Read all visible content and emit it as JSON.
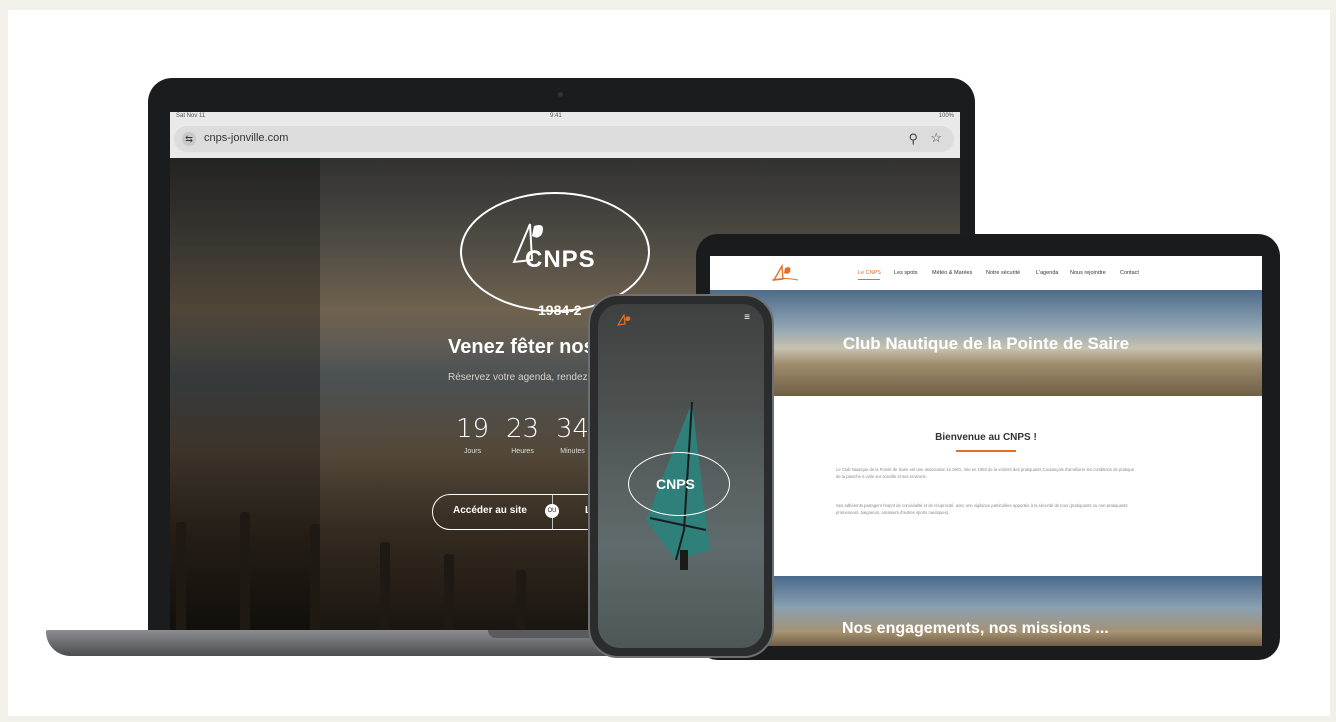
{
  "laptop": {
    "status_left": "Sat Nov 11",
    "status_center": "9:41",
    "status_right": "100%",
    "url": "cnps-jonville.com",
    "logo_text": "CNPS",
    "year_text": "1984-2",
    "hero_title": "Venez fêter nos",
    "hero_subtitle": "Réservez votre agenda, rendez vo",
    "countdown": [
      {
        "value": "19",
        "unit": "Jours"
      },
      {
        "value": "23",
        "unit": "Heures"
      },
      {
        "value": "34",
        "unit": "Minutes"
      }
    ],
    "btn_access": "Accéder au site",
    "btn_or": "OU",
    "btn_second": "Le"
  },
  "tablet": {
    "nav": [
      "Le CNPS",
      "Les spots",
      "Météo & Marées",
      "Notre sécurité",
      "L'agenda",
      "Nous rejoindre",
      "Contact"
    ],
    "hero_title": "Club Nautique de la Pointe de Saire",
    "welcome_title": "Bienvenue au CNPS !",
    "para1": "Le Club Nautique de la Pointe de Saire est une association loi 1901, née en 1984 de la volonté des pratiquants Coutançais d'améliorer les conditions de pratique de la planche à voile sur Jonville et ses environs.",
    "para2": "Ses adhérents partagent l'esprit de convivialité et de réciprocité, avec une vigilance particulière apportée à la sécurité de tous (pratiquants ou non-pratiquants promeneurs, baigneurs, amateurs d'autres sports nautiques).",
    "hero2_title": "Nos engagements, nos missions ..."
  },
  "phone": {
    "logo_text": "CNPS",
    "menu_icon": "hamburger-icon"
  },
  "colors": {
    "accent": "#e0702a"
  }
}
